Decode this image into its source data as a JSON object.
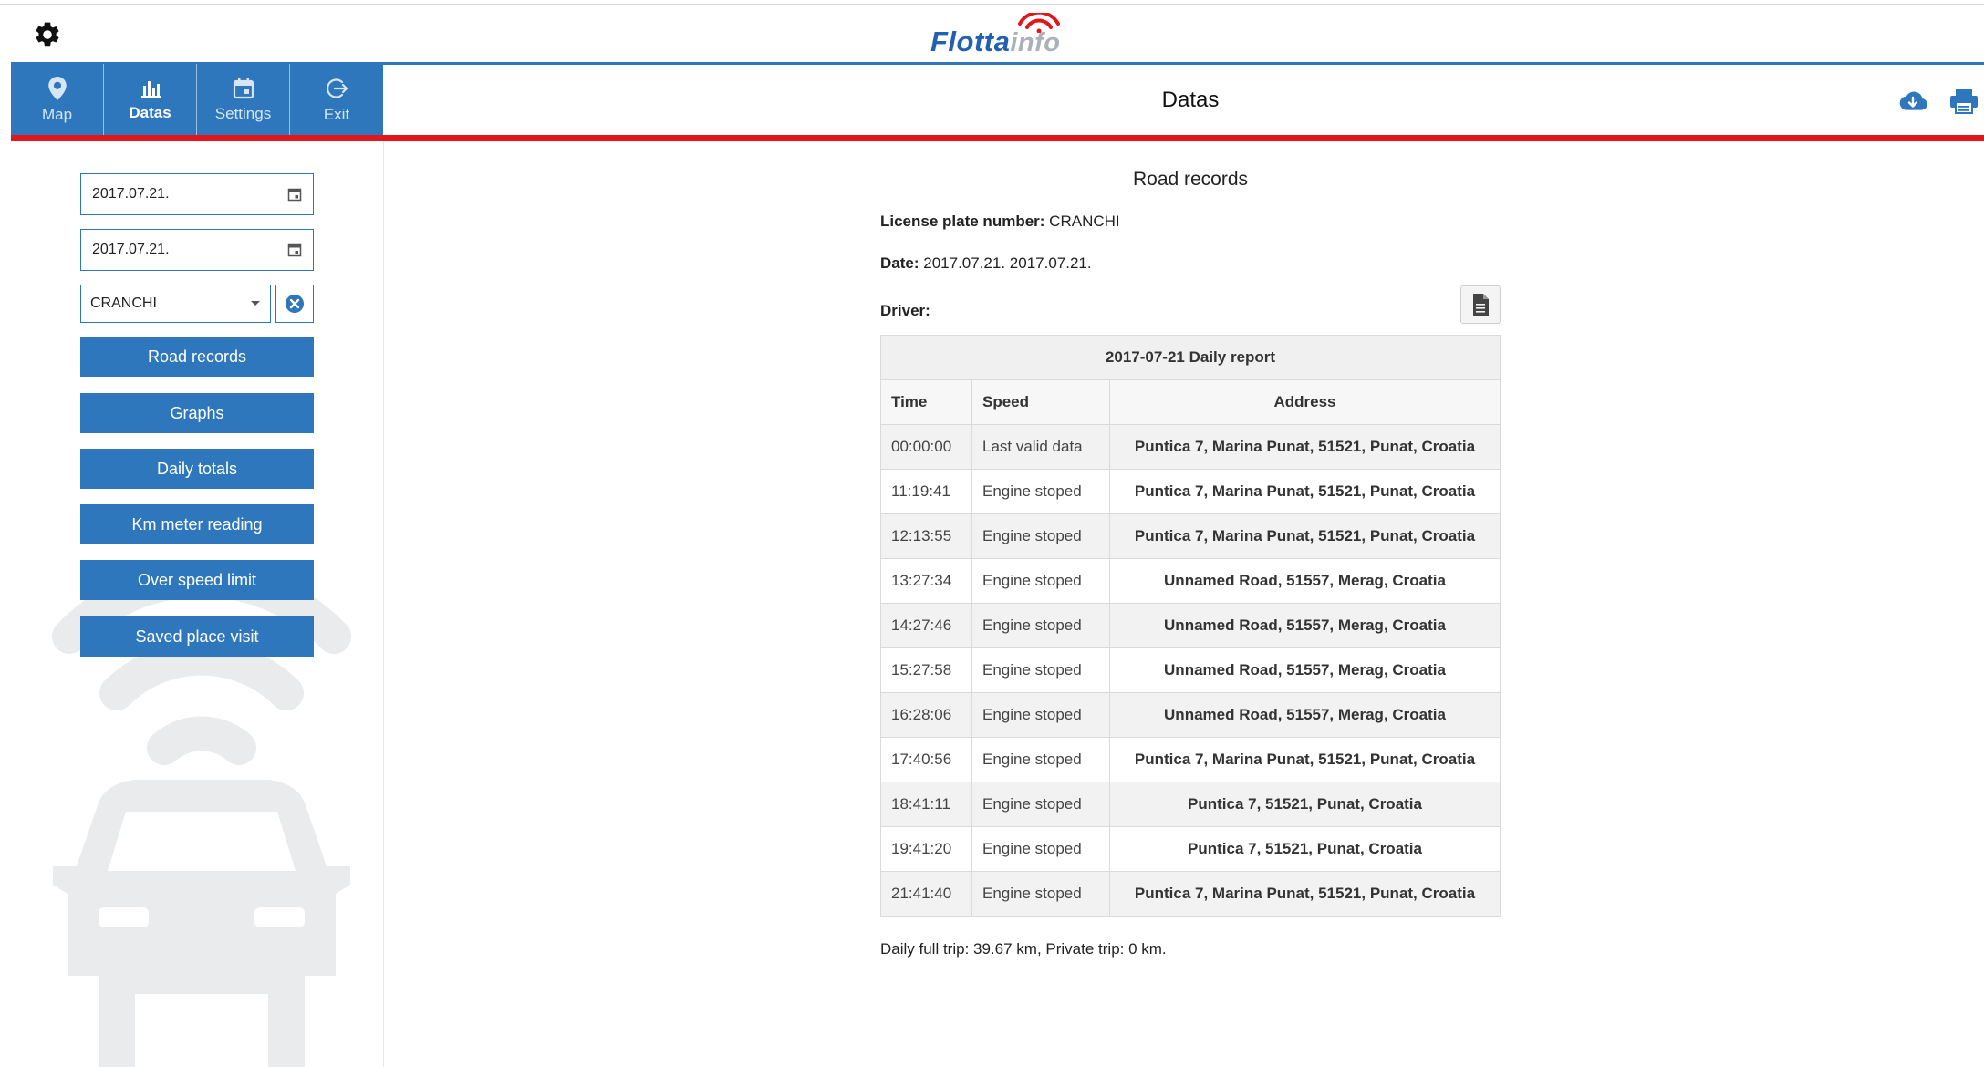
{
  "logo": {
    "part1": "Flotta",
    "part2": "info"
  },
  "nav": [
    {
      "label": "Map",
      "icon": "map-pin-icon",
      "active": false
    },
    {
      "label": "Datas",
      "icon": "bar-chart-icon",
      "active": true
    },
    {
      "label": "Settings",
      "icon": "calendar-icon",
      "active": false
    },
    {
      "label": "Exit",
      "icon": "logout-icon",
      "active": false
    }
  ],
  "header": {
    "title": "Datas",
    "icons": [
      "cloud-download-icon",
      "printer-icon"
    ]
  },
  "colors": {
    "primary": "#2e77bc",
    "accent_red": "#e2161b",
    "logo_gray": "#aab1b8",
    "watermark": "#e9ebec"
  },
  "sidebar": {
    "date_from": "2017.07.21.",
    "date_to": "2017.07.21.",
    "vehicle": "CRANCHI",
    "buttons": [
      "Road records",
      "Graphs",
      "Daily totals",
      "Km meter reading",
      "Over speed limit",
      "Saved place visit"
    ]
  },
  "report": {
    "title": "Road records",
    "plate_label": "License plate number:",
    "plate_value": "CRANCHI",
    "date_label": "Date:",
    "date_value": "2017.07.21. 2017.07.21.",
    "driver_label": "Driver:",
    "driver_value": "",
    "table_caption": "2017-07-21 Daily report",
    "columns": [
      "Time",
      "Speed",
      "Address"
    ],
    "rows": [
      [
        "00:00:00",
        "Last valid data",
        "Puntica 7, Marina Punat, 51521, Punat, Croatia"
      ],
      [
        "11:19:41",
        "Engine stoped",
        "Puntica 7, Marina Punat, 51521, Punat, Croatia"
      ],
      [
        "12:13:55",
        "Engine stoped",
        "Puntica 7, Marina Punat, 51521, Punat, Croatia"
      ],
      [
        "13:27:34",
        "Engine stoped",
        "Unnamed Road, 51557, Merag, Croatia"
      ],
      [
        "14:27:46",
        "Engine stoped",
        "Unnamed Road, 51557, Merag, Croatia"
      ],
      [
        "15:27:58",
        "Engine stoped",
        "Unnamed Road, 51557, Merag, Croatia"
      ],
      [
        "16:28:06",
        "Engine stoped",
        "Unnamed Road, 51557, Merag, Croatia"
      ],
      [
        "17:40:56",
        "Engine stoped",
        "Puntica 7, Marina Punat, 51521, Punat, Croatia"
      ],
      [
        "18:41:11",
        "Engine stoped",
        "Puntica 7, 51521, Punat, Croatia"
      ],
      [
        "19:41:20",
        "Engine stoped",
        "Puntica 7, 51521, Punat, Croatia"
      ],
      [
        "21:41:40",
        "Engine stoped",
        "Puntica 7, Marina Punat, 51521, Punat, Croatia"
      ]
    ],
    "summary": "Daily full trip: 39.67 km, Private trip: 0 km."
  }
}
